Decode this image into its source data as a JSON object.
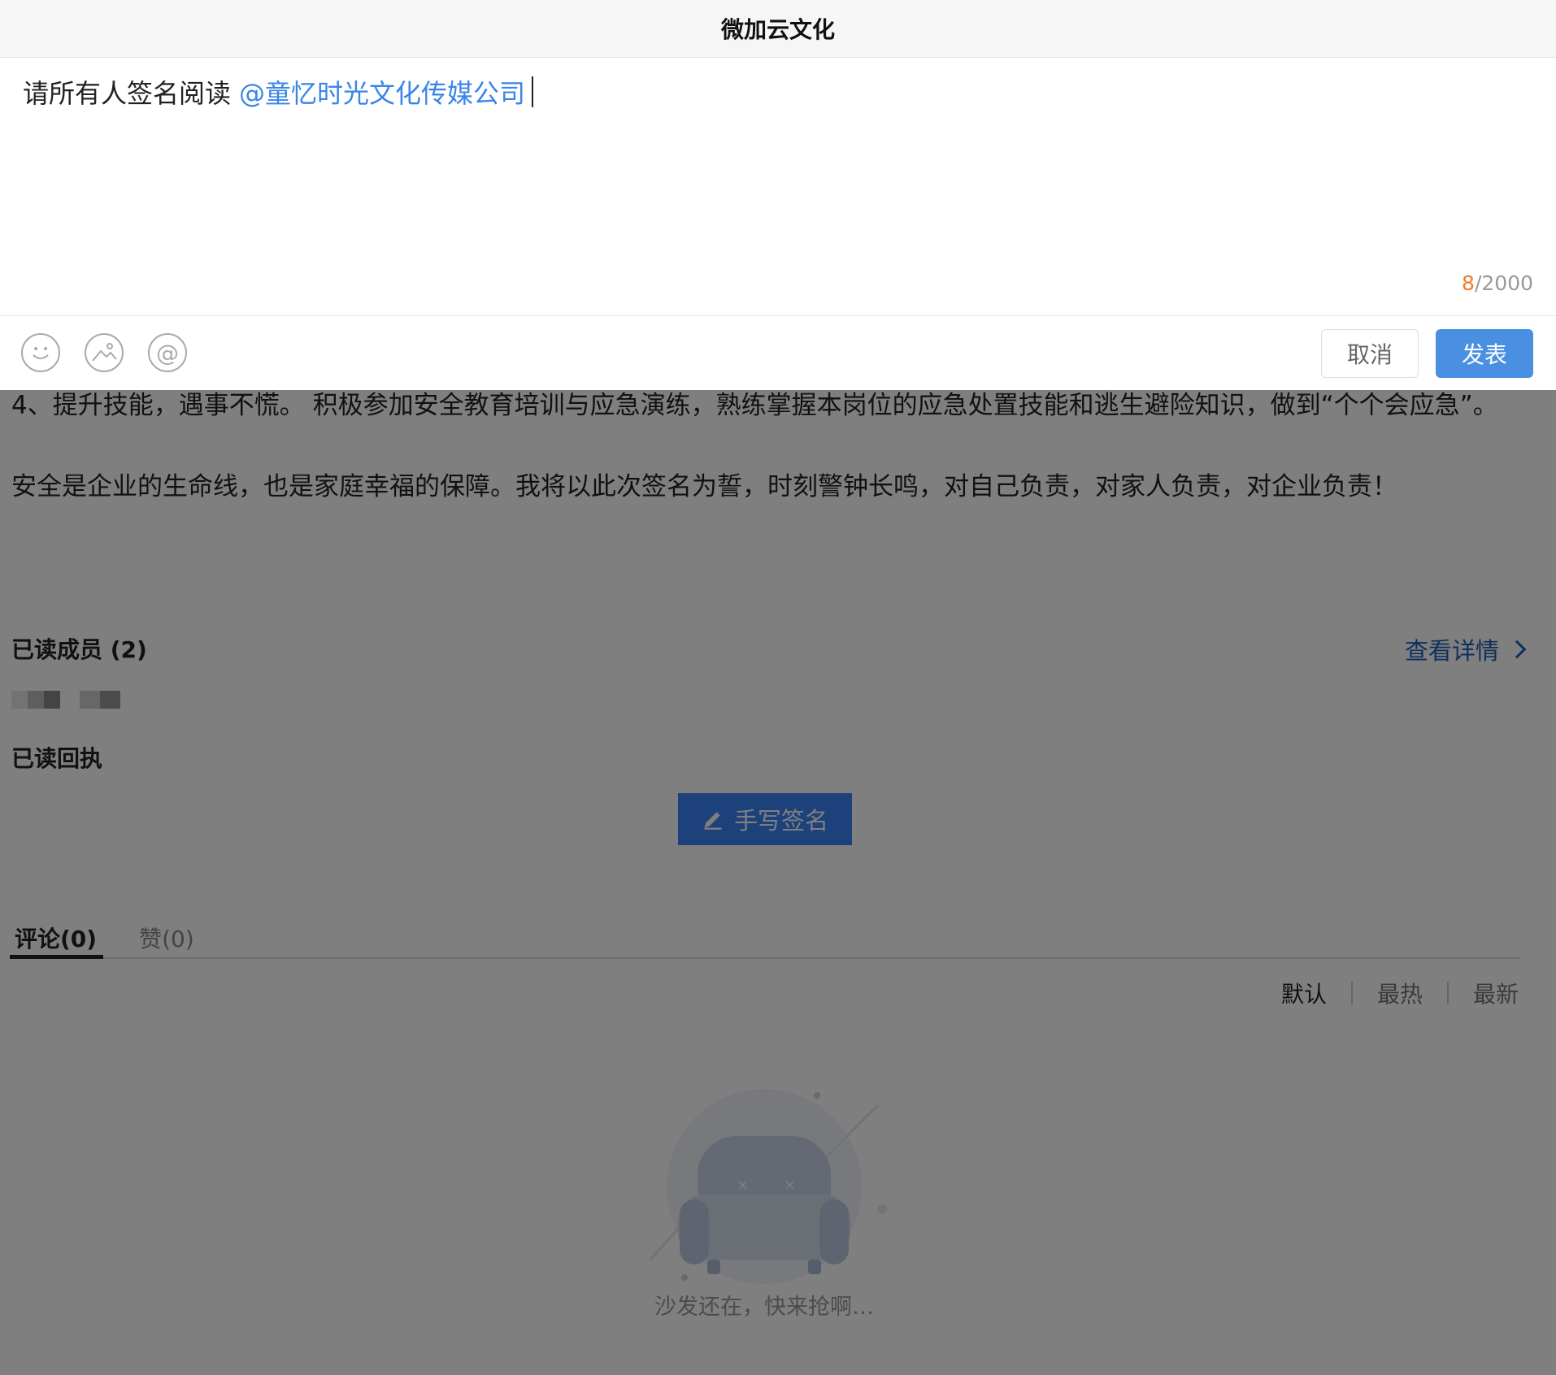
{
  "composer": {
    "title": "微加云文化",
    "text": "请所有人签名阅读",
    "mention": "@童忆时光文化传媒公司",
    "count_current": "8",
    "count_max": "/2000",
    "tools": [
      "emoji-icon",
      "image-icon",
      "at-icon"
    ],
    "cancel_label": "取消",
    "post_label": "发表"
  },
  "article": {
    "paragraphs": [
      "4、提升技能，遇事不慌。 积极参加安全教育培训与应急演练，熟练掌握本岗位的应急处置技能和逃生避险知识，做到“个个会应急”。",
      "安全是企业的生命线，也是家庭幸福的保障。我将以此次签名为誓，时刻警钟长鸣，对自己负责，对家人负责，对企业负责！"
    ]
  },
  "read_members": {
    "title": "已读成员 (2)",
    "detail_link": "查看详情"
  },
  "receipt": {
    "title": "已读回执",
    "sign_button": "手写签名"
  },
  "tabs": [
    "评论(0)",
    "赞(0)"
  ],
  "sort": [
    "默认",
    "最热",
    "最新"
  ],
  "empty_text": "沙发还在，快来抢啊…"
}
